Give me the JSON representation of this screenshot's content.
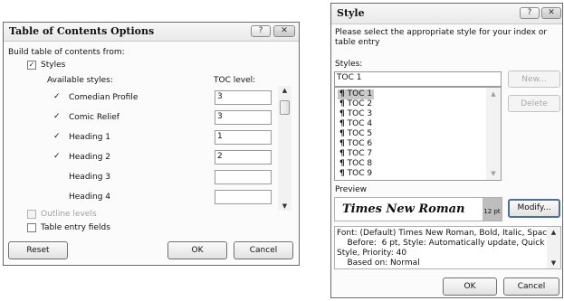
{
  "toc_dialog": {
    "title": "Table of Contents Options",
    "help": "?",
    "close": "✕",
    "build_label": "Build table of contents from:",
    "styles_check": {
      "checked": true,
      "label": "Styles",
      "mark": "✓"
    },
    "available_styles_header": "Available styles:",
    "toc_level_header": "TOC level:",
    "rows": [
      {
        "mark": "✓",
        "name": "Comedian Profile",
        "level": "3"
      },
      {
        "mark": "✓",
        "name": "Comic Relief",
        "level": "3"
      },
      {
        "mark": "✓",
        "name": "Heading 1",
        "level": "1"
      },
      {
        "mark": "✓",
        "name": "Heading 2",
        "level": "2"
      },
      {
        "mark": "",
        "name": "Heading 3",
        "level": ""
      },
      {
        "mark": "",
        "name": "Heading 4",
        "level": ""
      }
    ],
    "outline_levels": {
      "checked": false,
      "label": "Outline levels"
    },
    "table_entry_fields": {
      "checked": false,
      "label": "Table entry fields"
    },
    "reset": "Reset",
    "ok": "OK",
    "cancel": "Cancel"
  },
  "style_dialog": {
    "title": "Style",
    "help": "?",
    "close": "✕",
    "instruction": "Please select the appropriate style for your index or table entry",
    "styles_label": "Styles:",
    "style_input": "TOC 1",
    "new_button": "New...",
    "delete_button": "Delete",
    "pilcrow": "¶",
    "style_list": [
      "TOC 1",
      "TOC 2",
      "TOC 3",
      "TOC 4",
      "TOC 5",
      "TOC 6",
      "TOC 7",
      "TOC 8",
      "TOC 9"
    ],
    "selected": "TOC 1",
    "preview_label": "Preview",
    "preview_font": "Times New Roman",
    "preview_size": "12 pt",
    "modify_button": "Modify...",
    "description_lines": [
      "Font: (Default) Times New Roman, Bold, Italic, Space",
      "    Before:  6 pt, Style: Automatically update, Quick",
      "Style, Priority: 40",
      "    Based on: Normal"
    ],
    "ok": "OK",
    "cancel": "Cancel"
  }
}
